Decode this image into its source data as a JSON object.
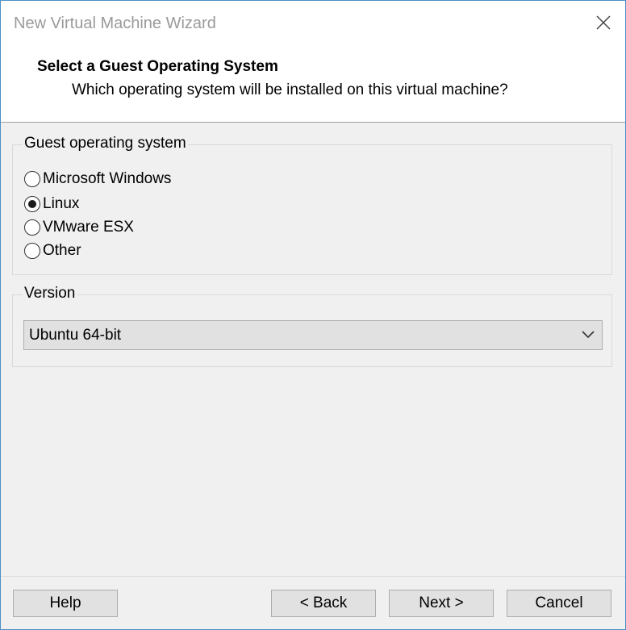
{
  "window": {
    "title": "New Virtual Machine Wizard"
  },
  "header": {
    "title": "Select a Guest Operating System",
    "subtitle": "Which operating system will be installed on this virtual machine?"
  },
  "guest_os": {
    "legend": "Guest operating system",
    "options": [
      {
        "label": "Microsoft Windows",
        "checked": false
      },
      {
        "label": "Linux",
        "checked": true
      },
      {
        "label": "VMware ESX",
        "checked": false
      },
      {
        "label": "Other",
        "checked": false
      }
    ]
  },
  "version": {
    "legend": "Version",
    "selected": "Ubuntu 64-bit"
  },
  "buttons": {
    "help": "Help",
    "back": "< Back",
    "next": "Next >",
    "cancel": "Cancel"
  },
  "icons": {
    "close": "close-icon",
    "dropdown": "chevron-down-icon"
  }
}
